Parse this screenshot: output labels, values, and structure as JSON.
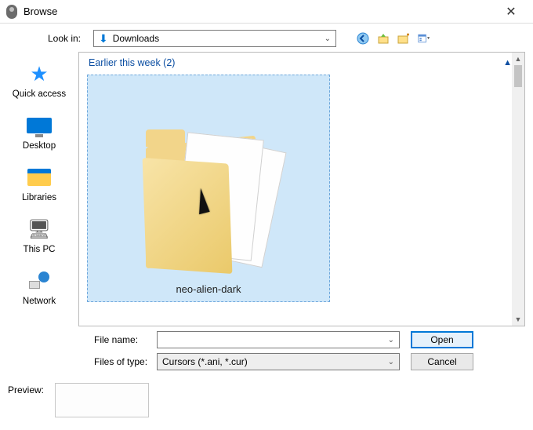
{
  "window": {
    "title": "Browse",
    "close_glyph": "✕"
  },
  "lookin": {
    "label": "Look in:",
    "value": "Downloads"
  },
  "nav_tools": {
    "back": "◀",
    "up": "↥",
    "new_folder": "▣",
    "view": "▦"
  },
  "sidebar": {
    "items": [
      {
        "name": "quick-access",
        "label": "Quick access"
      },
      {
        "name": "desktop",
        "label": "Desktop"
      },
      {
        "name": "libraries",
        "label": "Libraries"
      },
      {
        "name": "this-pc",
        "label": "This PC"
      },
      {
        "name": "network",
        "label": "Network"
      }
    ]
  },
  "group": {
    "header": "Earlier this week (2)",
    "collapse_glyph": "▲"
  },
  "selected_item": {
    "label": "neo-alien-dark"
  },
  "filename": {
    "label": "File name:",
    "value": ""
  },
  "filetype": {
    "label": "Files of type:",
    "value": "Cursors (*.ani, *.cur)"
  },
  "buttons": {
    "open": "Open",
    "cancel": "Cancel"
  },
  "preview": {
    "label": "Preview:"
  }
}
